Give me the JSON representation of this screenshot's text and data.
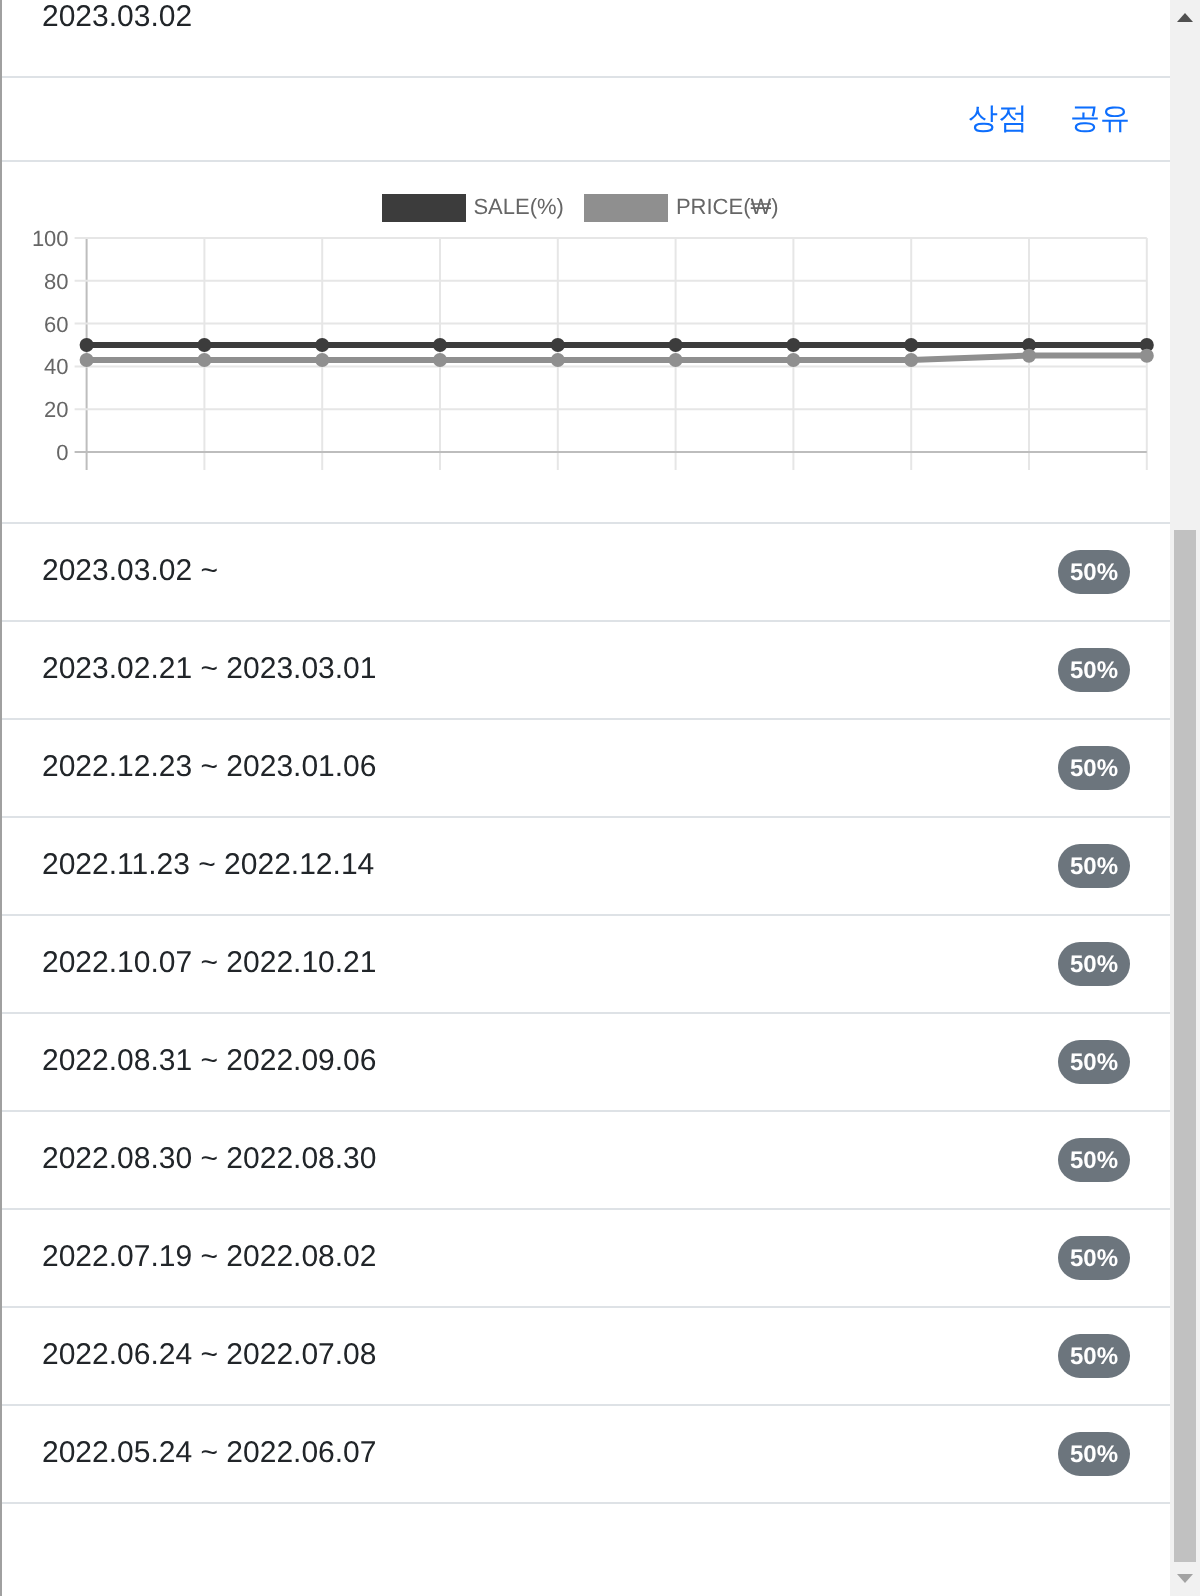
{
  "top_date": {
    "text": "2023.03.02"
  },
  "header": {
    "links": [
      "상점",
      "공유"
    ]
  },
  "chart": {
    "chart_data": {
      "type": "line",
      "ylim": [
        0,
        100
      ],
      "yticks": [
        0,
        20,
        40,
        60,
        80,
        100
      ],
      "grid": true,
      "legend": true,
      "series": [
        {
          "name": "SALE(%)",
          "color": "#3c3c3c",
          "marker": "circle",
          "values": [
            50,
            50,
            50,
            50,
            50,
            50,
            50,
            50,
            50,
            50
          ]
        },
        {
          "name": "PRICE(₩)",
          "color": "#8f8f8f",
          "marker": "circle",
          "values": [
            43,
            43,
            43,
            43,
            43,
            43,
            43,
            43,
            45,
            45
          ]
        }
      ]
    }
  },
  "periods": [
    {
      "range": "2023.03.02 ~",
      "discount": "50%"
    },
    {
      "range": "2023.02.21 ~ 2023.03.01",
      "discount": "50%"
    },
    {
      "range": "2022.12.23 ~ 2023.01.06",
      "discount": "50%"
    },
    {
      "range": "2022.11.23 ~ 2022.12.14",
      "discount": "50%"
    },
    {
      "range": "2022.10.07 ~ 2022.10.21",
      "discount": "50%"
    },
    {
      "range": "2022.08.31 ~ 2022.09.06",
      "discount": "50%"
    },
    {
      "range": "2022.08.30 ~ 2022.08.30",
      "discount": "50%"
    },
    {
      "range": "2022.07.19 ~ 2022.08.02",
      "discount": "50%"
    },
    {
      "range": "2022.06.24 ~ 2022.07.08",
      "discount": "50%"
    },
    {
      "range": "2022.05.24 ~ 2022.06.07",
      "discount": "50%"
    }
  ]
}
